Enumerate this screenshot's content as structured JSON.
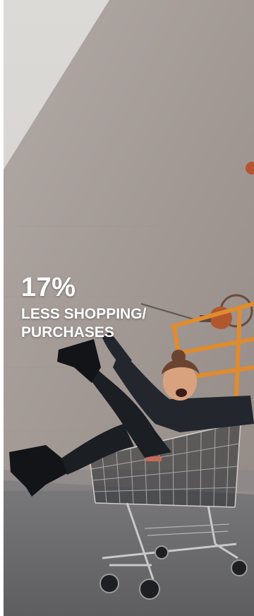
{
  "stat": {
    "value": "17%",
    "label": "LESS SHOPPING/\nPURCHASES"
  },
  "photo": {
    "icon": "shopping-cart-photo",
    "colors": {
      "sky": "#d9d7d4",
      "wall": "#a59c98",
      "wall_shadow": "#8e8581",
      "ground": "#6c6b6d",
      "rail": "#e08b2e",
      "clothing": "#1b1e23",
      "cart": "#bfbfbf"
    }
  }
}
